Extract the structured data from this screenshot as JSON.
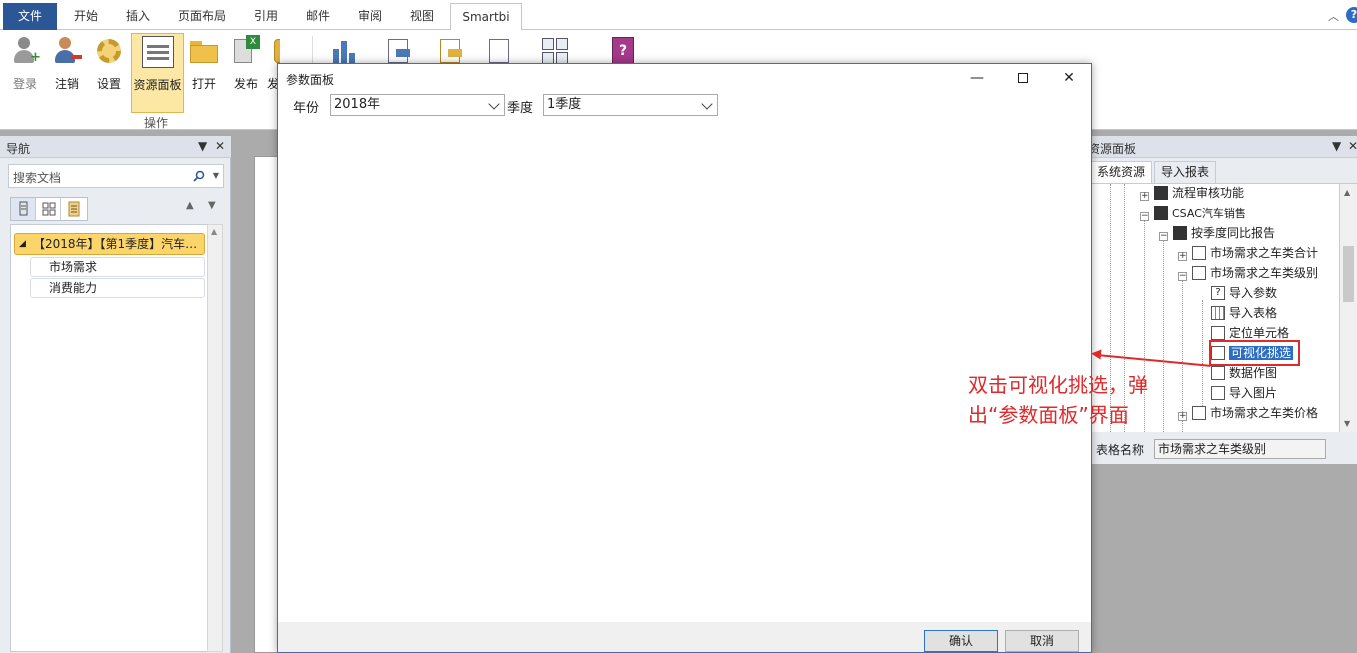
{
  "tabs": {
    "file": "文件",
    "items": [
      "开始",
      "插入",
      "页面布局",
      "引用",
      "邮件",
      "审阅",
      "视图"
    ],
    "active": "Smartbi"
  },
  "ribbon": {
    "buttons": [
      "登录",
      "注销",
      "设置",
      "资源面板",
      "打开",
      "发布",
      "发"
    ],
    "group_label": "操作",
    "selected": "资源面板"
  },
  "nav": {
    "title": "导航",
    "search_placeholder": "搜索文档",
    "head": "【2018年】【第1季度】汽车…",
    "items": [
      "市场需求",
      "消费能力"
    ]
  },
  "resource": {
    "title": "资源面板",
    "tabs": [
      "系统资源",
      "导入报表"
    ],
    "tree": [
      "流程审核功能",
      "CSAC汽车销售",
      "按季度同比报告",
      "市场需求之车类合计",
      "市场需求之车类级别",
      "导入参数",
      "导入表格",
      "定位单元格",
      "可视化挑选",
      "数据作图",
      "导入图片",
      "市场需求之车类价格"
    ],
    "footer_label": "表格名称",
    "footer_value": "市场需求之车类级别"
  },
  "annotation": {
    "line1": "双击可视化挑选，弹",
    "line2": "出“参数面板”界面",
    "color": "#e0292a"
  },
  "dialog": {
    "title": "参数面板",
    "param1_label": "年份",
    "param1_value": "2018年",
    "param2_label": "季度",
    "param2_value": "1季度",
    "ok": "确认",
    "cancel": "取消"
  }
}
